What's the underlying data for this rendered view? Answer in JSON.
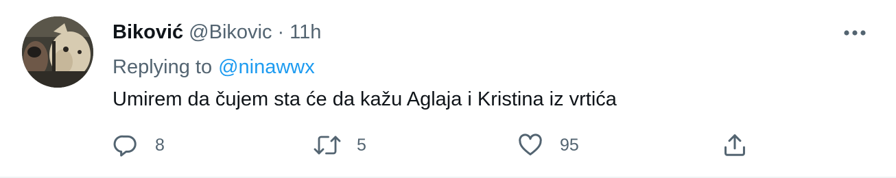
{
  "tweet": {
    "display_name": "Biković",
    "handle": "@Bikovic",
    "separator": "·",
    "time": "11h",
    "replying_prefix": "Replying to",
    "replying_to": "@ninawwx",
    "text": "Umirem da čujem sta će da kažu Aglaja i Kristina iz vrtića",
    "actions": {
      "reply_count": "8",
      "retweet_count": "5",
      "like_count": "95"
    },
    "icons": {
      "reply": "reply-icon",
      "retweet": "retweet-icon",
      "like": "heart-icon",
      "share": "share-icon",
      "more": "more-icon"
    },
    "colors": {
      "text": "#0f1419",
      "secondary": "#536471",
      "link": "#1d9bf0",
      "border": "#eff3f4"
    }
  }
}
